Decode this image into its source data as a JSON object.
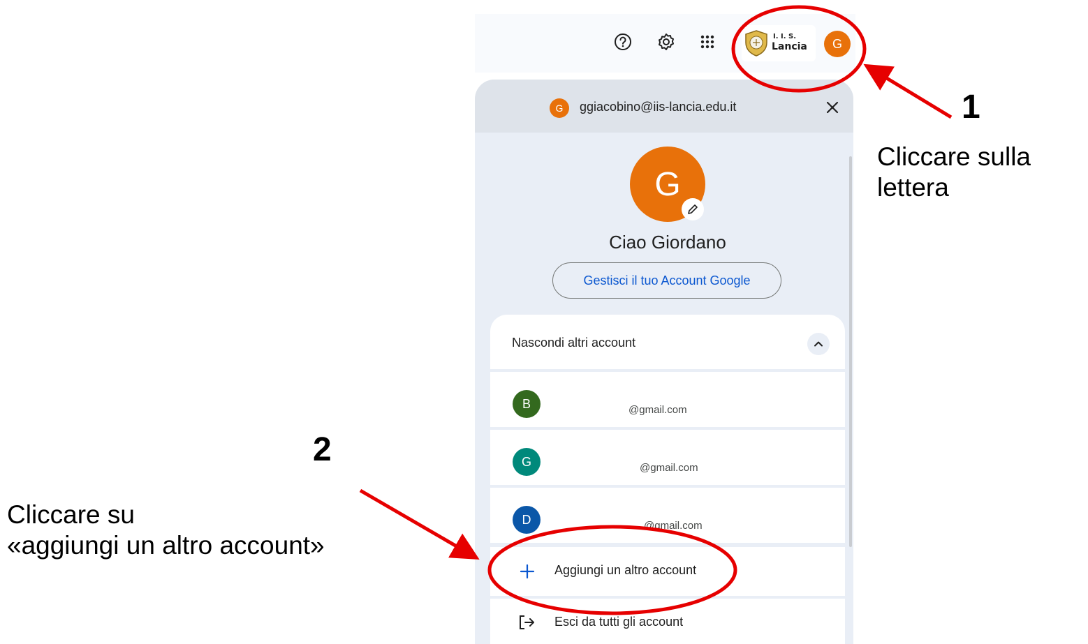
{
  "topbar": {
    "org_name_line1": "I. I. S.",
    "org_name_line2": "Lancia",
    "avatar_letter": "G"
  },
  "panel": {
    "header_avatar_letter": "G",
    "email": "ggiacobino@iis-lancia.edu.it",
    "big_avatar_letter": "G",
    "greeting": "Ciao Giordano",
    "manage_button": "Gestisci il tuo Account Google",
    "toggle_label": "Nascondi altri account",
    "accounts": [
      {
        "letter": "B",
        "email": "@gmail.com",
        "color": "#33691e"
      },
      {
        "letter": "G",
        "email": "@gmail.com",
        "color": "#00897b"
      },
      {
        "letter": "D",
        "email": "@gmail.com",
        "color": "#0b57a8"
      }
    ],
    "add_account": "Aggiungi un altro account",
    "sign_out_all": "Esci da tutti gli account"
  },
  "annotations": {
    "step1_number": "1",
    "step1_line1": "Cliccare sulla",
    "step1_line2": "lettera",
    "step2_number": "2",
    "step2_line1": "Cliccare su",
    "step2_line2": "«aggiungi un altro account»",
    "color": "#e60000"
  },
  "colors": {
    "avatar_orange": "#e8710a",
    "link_blue": "#0b57d0",
    "panel_bg": "#e9eef6"
  },
  "icons": [
    "help-icon",
    "gear-icon",
    "apps-grid-icon",
    "close-icon",
    "pencil-icon",
    "chevron-up-icon",
    "plus-icon",
    "sign-out-icon"
  ]
}
